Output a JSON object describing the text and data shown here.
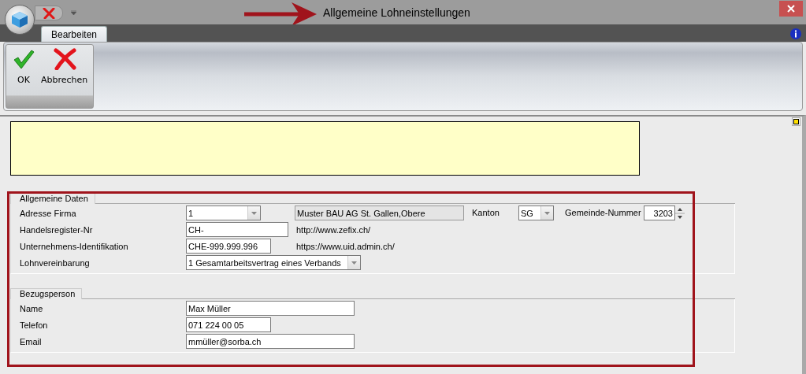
{
  "window": {
    "title": "Allgemeine Lohneinstellungen"
  },
  "tabs": [
    {
      "label": "Bearbeiten",
      "selected": true
    }
  ],
  "ribbon_buttons": [
    {
      "label": "OK",
      "kind": "ok"
    },
    {
      "label": "Abbrechen",
      "kind": "cancel"
    }
  ],
  "groups": [
    {
      "title": "Allgemeine Daten",
      "rows": [
        {
          "label": "Adresse Firma",
          "fields": [
            {
              "kind": "combo",
              "value": "1"
            },
            {
              "kind": "readonly",
              "value": "Muster BAU AG St. Gallen,Obere"
            },
            {
              "kind": "label",
              "text": "Kanton"
            },
            {
              "kind": "combo",
              "value": "SG"
            },
            {
              "kind": "label",
              "text": "Gemeinde-Nummer"
            },
            {
              "kind": "spin",
              "value": "3203"
            }
          ]
        },
        {
          "label": "Handelsregister-Nr",
          "fields": [
            {
              "kind": "text",
              "value": "CH-"
            },
            {
              "kind": "link",
              "text": "http://www.zefix.ch/"
            }
          ]
        },
        {
          "label": "Unternehmens-Identifikation",
          "fields": [
            {
              "kind": "text",
              "value": "CHE-999.999.996"
            },
            {
              "kind": "link",
              "text": "https://www.uid.admin.ch/"
            }
          ]
        },
        {
          "label": "Lohnvereinbarung",
          "fields": [
            {
              "kind": "combo",
              "value": "1 Gesamtarbeitsvertrag eines Verbands"
            }
          ]
        }
      ]
    },
    {
      "title": "Bezugsperson",
      "rows": [
        {
          "label": "Name",
          "fields": [
            {
              "kind": "text",
              "value": "Max Müller"
            }
          ]
        },
        {
          "label": "Telefon",
          "fields": [
            {
              "kind": "text",
              "value": "071 224 00 05"
            }
          ]
        },
        {
          "label": "Email",
          "fields": [
            {
              "kind": "text",
              "value": "mmüller@sorba.ch"
            }
          ]
        }
      ]
    }
  ]
}
